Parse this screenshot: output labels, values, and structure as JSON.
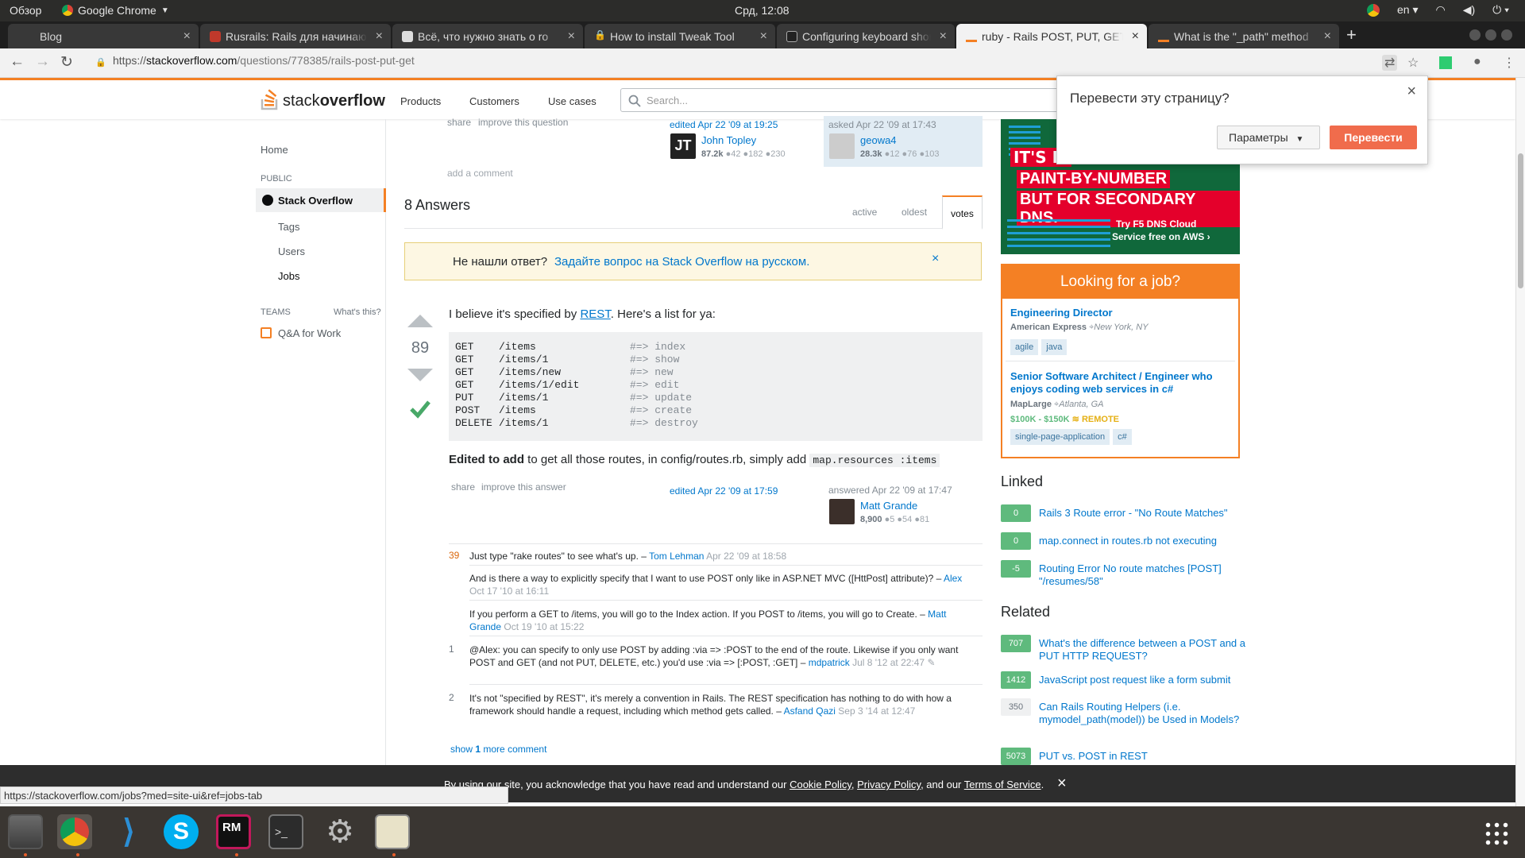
{
  "os": {
    "overview": "Обзор",
    "app_name": "Google Chrome",
    "clock": "Срд, 12:08",
    "lang": "en"
  },
  "tabs": [
    {
      "title": "Blog"
    },
    {
      "title": "Rusrails: Rails для начинающих"
    },
    {
      "title": "Всё, что нужно знать о ro"
    },
    {
      "title": "How to install Tweak Tool"
    },
    {
      "title": "Configuring keyboard shortcuts"
    },
    {
      "title": "ruby - Rails POST, PUT, GET"
    },
    {
      "title": "What is the \"_path\" method"
    }
  ],
  "address": {
    "scheme": "https://",
    "host": "stackoverflow.com",
    "path": "/questions/778385/rails-post-put-get"
  },
  "so_header": {
    "logo_a": "stack",
    "logo_b": "overflow",
    "nav": [
      "Products",
      "Customers",
      "Use cases"
    ],
    "search_placeholder": "Search..."
  },
  "sidebar": {
    "home": "Home",
    "public": "PUBLIC",
    "stack_overflow": "Stack Overflow",
    "tags": "Tags",
    "users": "Users",
    "jobs": "Jobs",
    "teams": "TEAMS",
    "whats_this": "What's this?",
    "qa_for_work": "Q&A for Work"
  },
  "question_footer": {
    "share": "share",
    "improve": "improve this question",
    "edited": "edited Apr 22 '09 at 19:25",
    "editor_name": "John Topley",
    "editor_rep": "87.2k",
    "editor_badges": "●42 ●182 ●230",
    "asked": "asked Apr 22 '09 at 17:43",
    "asker_name": "geowa4",
    "asker_rep": "28.3k",
    "asker_badges": "●12 ●76 ●103",
    "add_comment": "add a comment"
  },
  "answers_header": {
    "count": "8 Answers",
    "sort_tabs": [
      "active",
      "oldest",
      "votes"
    ]
  },
  "notice": {
    "text": "Не нашли ответ?",
    "link": "Задайте вопрос на Stack Overflow на русском.",
    "close": "×"
  },
  "answer": {
    "votes": "89",
    "intro_a": "I believe it's specified by",
    "intro_link": "REST",
    "intro_b": ". Here's a list for ya:",
    "code_lines": [
      [
        "GET",
        "/items",
        "#=> index"
      ],
      [
        "GET",
        "/items/1",
        "#=> show"
      ],
      [
        "GET",
        "/items/new",
        "#=> new"
      ],
      [
        "GET",
        "/items/1/edit",
        "#=> edit"
      ],
      [
        "PUT",
        "/items/1",
        "#=> update"
      ],
      [
        "POST",
        "/items",
        "#=> create"
      ],
      [
        "DELETE",
        "/items/1",
        "#=> destroy"
      ]
    ],
    "edited_bold": "Edited to add",
    "edited_text": "to get all those routes, in config/routes.rb, simply add",
    "edited_code": "map.resources :items",
    "share": "share",
    "improve": "improve this answer",
    "edited": "edited Apr 22 '09 at 17:59",
    "answered": "answered Apr 22 '09 at 17:47",
    "author": "Matt Grande",
    "author_rep": "8,900",
    "author_badges": "●5 ●54 ●81"
  },
  "comments": [
    {
      "score": "39",
      "text": "Just type \"rake routes\" to see what's up. –",
      "user": "Tom Lehman",
      "date": "Apr 22 '09 at 18:58"
    },
    {
      "score": "",
      "text": "And is there a way to explicitly specify that I want to use POST only like in ASP.NET MVC ([HttPost] attribute)? –",
      "user": "Alex",
      "date": "Oct 17 '10 at 16:11"
    },
    {
      "score": "",
      "text": "If you perform a GET to /items, you will go to the Index action. If you POST to /items, you will go to Create. –",
      "user": "Matt Grande",
      "date": "Oct 19 '10 at 15:22"
    },
    {
      "score": "1",
      "text": "@Alex: you can specify to only use POST by adding :via => :POST to the end of the route. Likewise if you only want POST and GET (and not PUT, DELETE, etc.) you'd use :via => [:POST, :GET] –",
      "user": "mdpatrick",
      "date": "Jul 8 '12 at 22:47"
    },
    {
      "score": "2",
      "text": "It's not \"specified by REST\", it's merely a convention in Rails. The REST specification has nothing to do with how a framework should handle a request, including which method gets called. –",
      "user": "Asfand Qazi",
      "date": "Sep 3 '14 at 12:47"
    }
  ],
  "show_more": {
    "a": "show",
    "b": "1",
    "c": "more comment"
  },
  "translate_popup": {
    "title": "Перевести эту страницу?",
    "options": "Параметры",
    "translate": "Перевести"
  },
  "ad": {
    "line1": "IT'S LI",
    "line2": "PAINT-BY-NUMBER",
    "line3": "BUT FOR SECONDARY DNS.",
    "cta1": "Try F5 DNS Cloud",
    "cta2": "Service free on AWS ›"
  },
  "jobs": {
    "header": "Looking for a job?",
    "items": [
      {
        "title": "Engineering Director",
        "company": "American Express",
        "location": "New York, NY",
        "tags": [
          "agile",
          "java"
        ],
        "salary": "",
        "remote": ""
      },
      {
        "title": "Senior Software Architect / Engineer who enjoys coding web services in c#",
        "company": "MapLarge",
        "location": "Atlanta, GA",
        "tags": [
          "single-page-application",
          "c#"
        ],
        "salary": "$100K - $150K",
        "remote": "REMOTE"
      }
    ]
  },
  "linked": {
    "header": "Linked",
    "items": [
      {
        "score": "0",
        "title": "Rails 3 Route error - \"No Route Matches\""
      },
      {
        "score": "0",
        "title": "map.connect in routes.rb not executing"
      },
      {
        "score": "-5",
        "title": "Routing Error No route matches [POST] \"/resumes/58\""
      }
    ]
  },
  "related": {
    "header": "Related",
    "items": [
      {
        "score": "707",
        "title": "What's the difference between a POST and a PUT HTTP REQUEST?",
        "accepted": true
      },
      {
        "score": "1412",
        "title": "JavaScript post request like a form submit",
        "accepted": true
      },
      {
        "score": "350",
        "title": "Can Rails Routing Helpers (i.e. mymodel_path(model)) be Used in Models?",
        "accepted": false
      },
      {
        "score": "5073",
        "title": "PUT vs. POST in REST",
        "accepted": true
      }
    ]
  },
  "cookie": {
    "a": "By using our site, you acknowledge that you have read and understand our",
    "cookie_policy": "Cookie Policy",
    "privacy_policy": "Privacy Policy",
    "and": ", and our",
    "terms": "Terms of Service",
    "close": "×"
  },
  "status_url": "https://stackoverflow.com/jobs?med=site-ui&ref=jobs-tab",
  "colors": {
    "accent": "#f48024",
    "link": "#0077cc",
    "vote_green": "#5fba7d",
    "translate_btn": "#f06c4c"
  }
}
